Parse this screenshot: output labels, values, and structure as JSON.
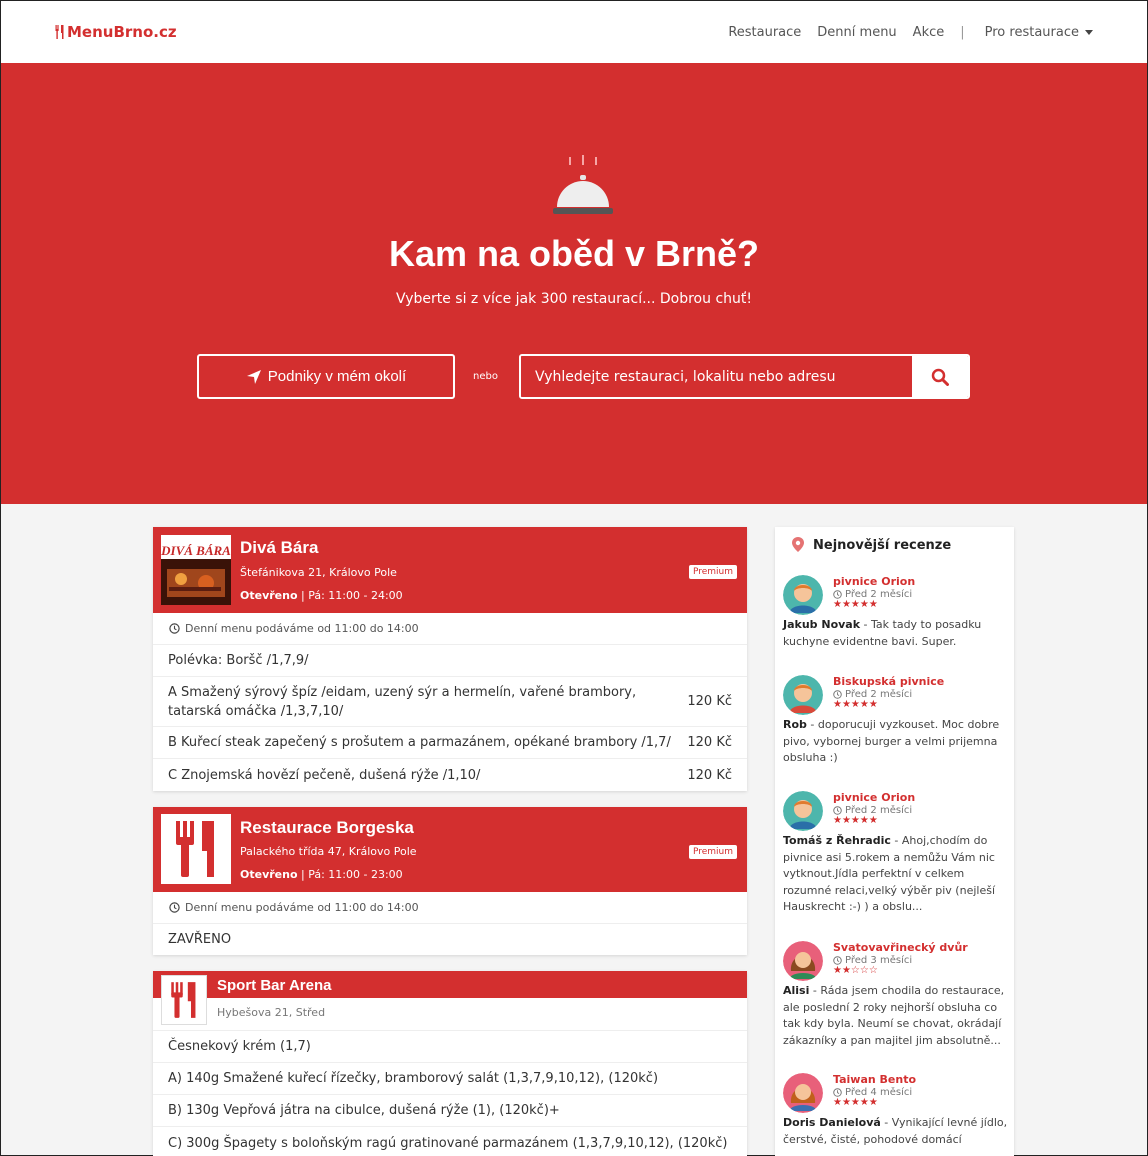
{
  "nav": {
    "logo": "MenuBrno.cz",
    "links": [
      "Restaurace",
      "Denní menu",
      "Akce"
    ],
    "separator": "|",
    "pro_restaurace": "Pro restaurace"
  },
  "hero": {
    "title": "Kam na oběd v Brně?",
    "subtitle": "Vyberte si z více jak 300 restaurací... Dobrou chuť!",
    "nearby_button": "Podniky v mém okolí",
    "or_label": "nebo",
    "search_placeholder": "Vyhledejte restauraci, lokalitu nebo adresu"
  },
  "restaurants": [
    {
      "name": "Divá Bára",
      "address": "Štefánikova 21, Královo Pole",
      "open_label": "Otevřeno",
      "hours": " | Pá: 11:00 - 24:00",
      "badge": "Premium",
      "menu_note": "Denní menu podáváme od 11:00 do 14:00",
      "items": [
        {
          "text": "Polévka: Boršč /1,7,9/",
          "price": ""
        },
        {
          "text": "A Smažený sýrový špíz /eidam, uzený sýr a hermelín, vařené brambory, tatarská omáčka /1,3,7,10/",
          "price": "120 Kč"
        },
        {
          "text": "B Kuřecí steak zapečený s prošutem a parmazánem, opékané brambory /1,7/",
          "price": "120 Kč"
        },
        {
          "text": "C Znojemská hovězí pečeně, dušená rýže /1,10/",
          "price": "120 Kč"
        }
      ]
    },
    {
      "name": "Restaurace Borgeska",
      "address": "Palackého třída 47, Královo Pole",
      "open_label": "Otevřeno",
      "hours": " | Pá: 11:00 - 23:00",
      "badge": "Premium",
      "menu_note": "Denní menu podáváme od 11:00 do 14:00",
      "items": [
        {
          "text": "ZAVŘENO",
          "price": ""
        }
      ]
    },
    {
      "name": "Sport Bar Arena",
      "address": "Hybešova 21, Střed",
      "items": [
        {
          "text": "Česnekový krém (1,7)",
          "price": ""
        },
        {
          "text": "A) 140g Smažené kuřecí řízečky, bramborový salát (1,3,7,9,10,12), (120kč)",
          "price": ""
        },
        {
          "text": "B) 130g Vepřová játra na cibulce, dušená rýže (1), (120kč)+",
          "price": ""
        },
        {
          "text": "C) 300g Špagety s boloňským ragú gratinované parmazánem (1,3,7,9,10,12), (120kč)",
          "price": ""
        }
      ]
    }
  ],
  "sidebar": {
    "title": "Nejnovější recenze",
    "reviews": [
      {
        "place": "pivnice Orion",
        "time": "Před 2 měsíci",
        "stars": "★★★★★",
        "author": "Jakub Novak",
        "text": " - Tak tady to posadku kuchyne evidentne bavi. Super."
      },
      {
        "place": "Biskupská pivnice",
        "time": "Před 2 měsíci",
        "stars": "★★★★★",
        "author": "Rob",
        "text": " - doporucuji vyzkouset. Moc dobre pivo, vybornej burger a velmi prijemna obsluha :)"
      },
      {
        "place": "pivnice Orion",
        "time": "Před 2 měsíci",
        "stars": "★★★★★",
        "author": "Tomáš z Řehradic",
        "text": " - Ahoj,chodím do pivnice asi 5.rokem a nemůžu Vám nic vytknout.Jídla perfektní v celkem rozumné relaci,velký výběr piv (nejleší Hauskrecht :-) ) a obslu..."
      },
      {
        "place": "Svatovavřinecký dvůr",
        "time": "Před 3 měsíci",
        "stars": "★★☆☆☆",
        "author": "Alisi",
        "text": " - Ráda jsem chodila do restaurace, ale poslední 2 roky nejhorší obsluha co tak kdy byla. Neumí se chovat, okrádají zákazníky a pan majitel jim absolutně..."
      },
      {
        "place": "Taiwan Bento",
        "time": "Před 4 měsíci",
        "stars": "★★★★★",
        "author": "Doris Danielová",
        "text": " - Vynikající levné jídlo, čerstvé, čisté, pohodové domácí"
      }
    ]
  },
  "colors": {
    "brand": "#d32f2f",
    "page_bg": "#f4f4f4"
  }
}
